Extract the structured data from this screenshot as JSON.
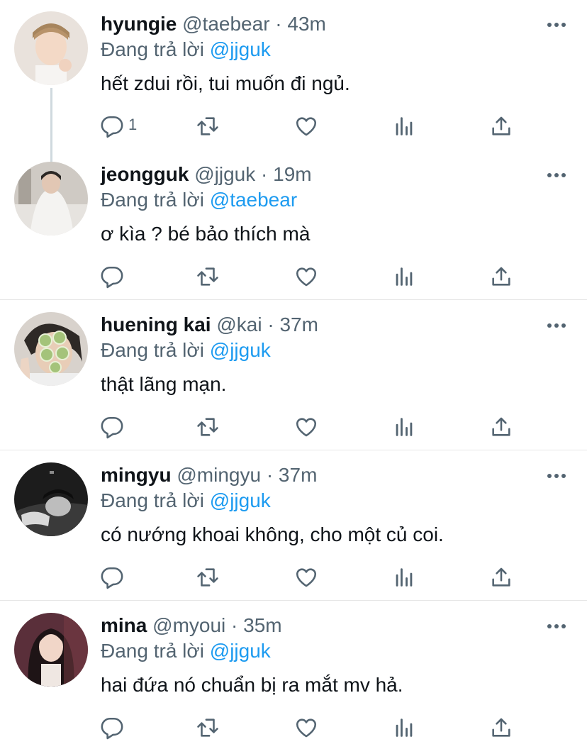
{
  "reply_prefix": "Đang trả lời",
  "tweets": [
    {
      "name": "hyungie",
      "handle": "@taebear",
      "separator": "·",
      "time": "43m",
      "reply_to": "@jjguk",
      "text": "hết zdui rồi, tui muốn đi ngủ.",
      "reply_count": "1",
      "avatar": "portrait-light"
    },
    {
      "name": "jeongguk",
      "handle": "@jjguk",
      "separator": "·",
      "time": "19m",
      "reply_to": "@taebear",
      "text": "ơ kìa ? bé bảo thích mà",
      "reply_count": "",
      "avatar": "portrait-bed"
    },
    {
      "name": "huening kai",
      "handle": "@kai",
      "separator": "·",
      "time": "37m",
      "reply_to": "@jjguk",
      "text": "thật lãng mạn.",
      "reply_count": "",
      "avatar": "portrait-cucumber-mask"
    },
    {
      "name": "mingyu",
      "handle": "@mingyu",
      "separator": "·",
      "time": "37m",
      "reply_to": "@jjguk",
      "text": "có nướng khoai không, cho một củ coi.",
      "reply_count": "",
      "avatar": "portrait-dark-bw"
    },
    {
      "name": "mina",
      "handle": "@myoui",
      "separator": "·",
      "time": "35m",
      "reply_to": "@jjguk",
      "text": "hai đứa nó chuẩn bị ra mắt mv hả.",
      "reply_count": "",
      "avatar": "portrait-dark-hair"
    }
  ],
  "icons": {
    "reply": "reply-icon",
    "retweet": "retweet-icon",
    "like": "heart-icon",
    "analytics": "analytics-icon",
    "share": "share-icon",
    "more": "more-icon"
  },
  "colors": {
    "name": "#0f1419",
    "secondary": "#536471",
    "mention": "#1d9bf0",
    "divider": "#e6e6e6",
    "thread_line": "#cfd9de"
  }
}
